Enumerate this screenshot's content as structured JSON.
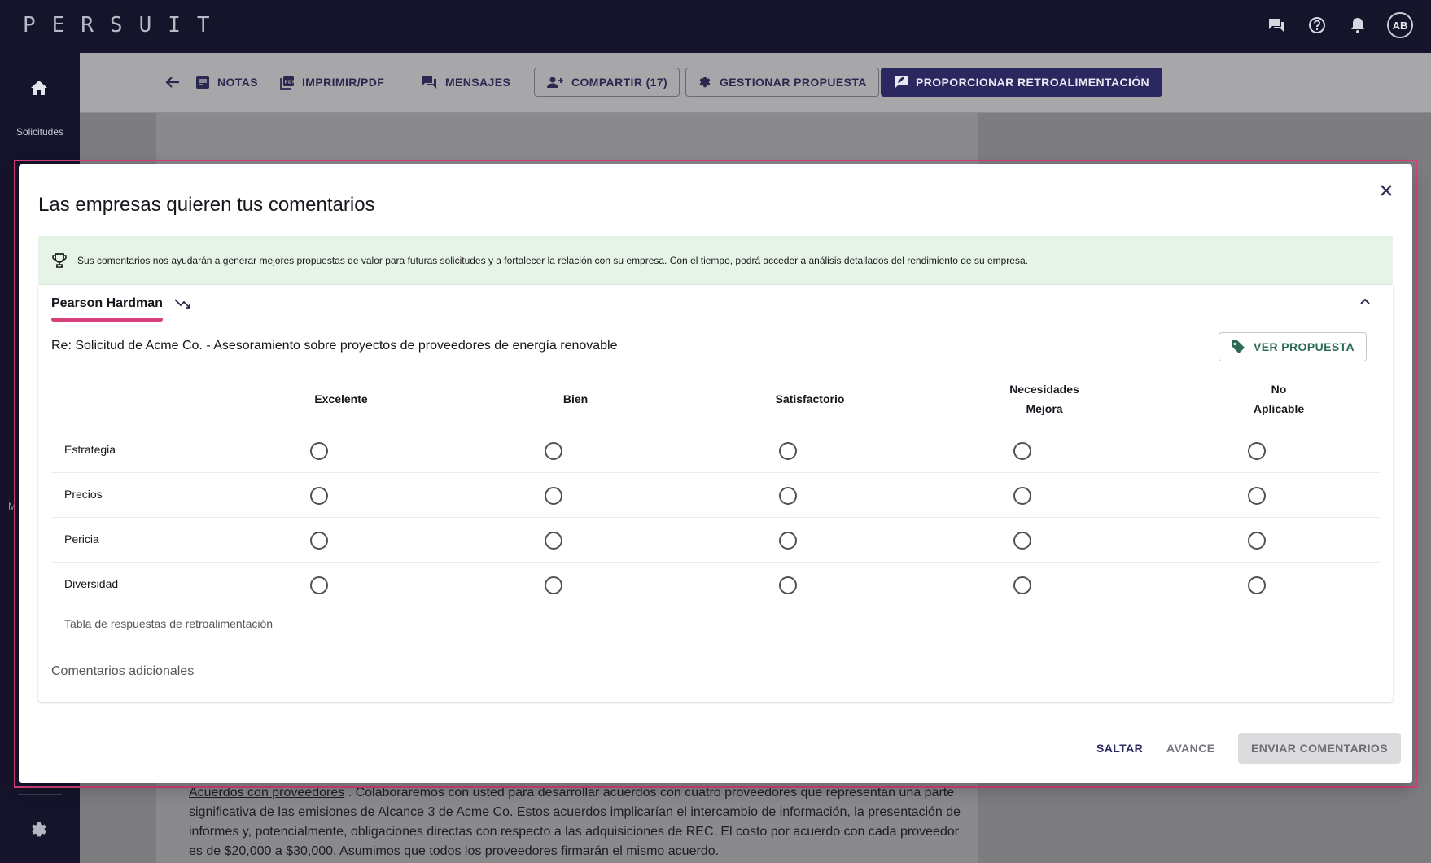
{
  "app": {
    "logo": "PERSUIT",
    "avatar_initials": "AB"
  },
  "topbar_icons": [
    "chat-icon",
    "help-icon",
    "bell-icon"
  ],
  "sidenav": {
    "home_label": "Solicitudes",
    "partial_label": "M"
  },
  "toolbar": {
    "notes": "NOTAS",
    "print": "IMPRIMIR/PDF",
    "messages": "MENSAJES",
    "share": "COMPARTIR (17)",
    "manage": "GESTIONAR PROPUESTA",
    "feedback": "PROPORCIONAR RETROALIMENTACIÓN"
  },
  "document": {
    "link": "Acuerdos con proveedores",
    "text": " . Colaboraremos con usted para desarrollar acuerdos con cuatro proveedores que representan una parte significativa de las emisiones de Alcance 3 de Acme Co. Estos acuerdos implicarían el intercambio de información, la presentación de informes y, potencialmente, obligaciones directas con respecto a las adquisiciones de REC. El costo por acuerdo con cada proveedor es de $20,000 a $30,000. Asumimos que todos los proveedores firmarán el mismo acuerdo."
  },
  "modal": {
    "title": "Las empresas quieren tus comentarios",
    "banner": "Sus comentarios nos ayudarán a generar mejores propuestas de valor para futuras solicitudes y a fortalecer la relación con su empresa. Con el tiempo, podrá acceder a análisis detallados del rendimiento de su empresa.",
    "firm_tab": "Pearson Hardman",
    "request_line": "Re: Solicitud de Acme Co. - Asesoramiento sobre proyectos de proveedores de energía renovable",
    "view_proposal": "VER PROPUESTA",
    "columns": [
      {
        "line1": "Excelente",
        "line2": ""
      },
      {
        "line1": "Bien",
        "line2": ""
      },
      {
        "line1": "Satisfactorio",
        "line2": ""
      },
      {
        "line1": "Necesidades",
        "line2": "Mejora"
      },
      {
        "line1": "No",
        "line2": "Aplicable"
      }
    ],
    "rows": [
      "Estrategia",
      "Precios",
      "Pericia",
      "Diversidad"
    ],
    "table_caption": "Tabla de respuestas de retroalimentación",
    "comments_label": "Comentarios adicionales",
    "skip": "SALTAR",
    "advance": "AVANCE",
    "submit": "ENVIAR COMENTARIOS"
  }
}
